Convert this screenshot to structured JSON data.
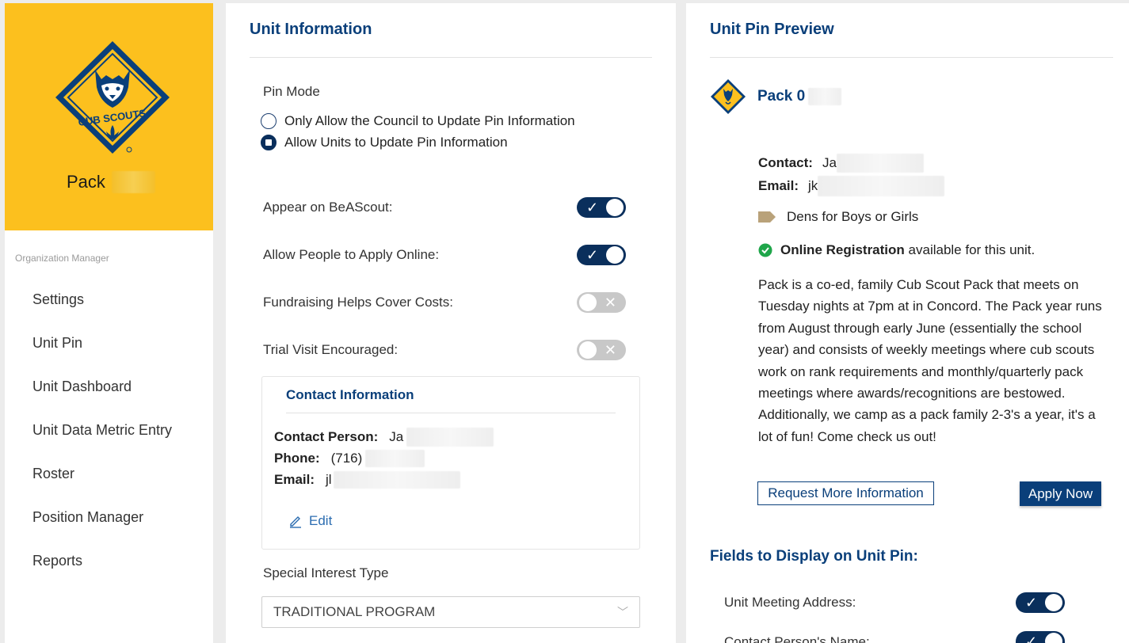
{
  "sidebar": {
    "logo_text": "CUB SCOUTS",
    "pack_name": "Pack",
    "org_label": "Organization Manager",
    "nav": [
      {
        "label": "Settings"
      },
      {
        "label": "Unit Pin"
      },
      {
        "label": "Unit Dashboard"
      },
      {
        "label": "Unit Data Metric Entry"
      },
      {
        "label": "Roster"
      },
      {
        "label": "Position Manager"
      },
      {
        "label": "Reports"
      }
    ]
  },
  "unit_info": {
    "title": "Unit Information",
    "pin_mode_label": "Pin Mode",
    "pin_mode_options": [
      {
        "label": "Only Allow the Council to Update Pin Information",
        "selected": false
      },
      {
        "label": "Allow Units to Update Pin Information",
        "selected": true
      }
    ],
    "toggles": [
      {
        "label": "Appear on BeAScout:",
        "on": true
      },
      {
        "label": "Allow People to Apply Online:",
        "on": true
      },
      {
        "label": "Fundraising Helps Cover Costs:",
        "on": false
      },
      {
        "label": "Trial Visit Encouraged:",
        "on": false
      }
    ],
    "contact": {
      "title": "Contact Information",
      "person_label": "Contact Person:",
      "person_value": "Ja",
      "phone_label": "Phone:",
      "phone_value": "(716)",
      "email_label": "Email:",
      "email_value": "jl",
      "edit_label": "Edit"
    },
    "special_interest_label": "Special Interest Type",
    "special_interest_value": "TRADITIONAL PROGRAM"
  },
  "pin_preview": {
    "title": "Unit Pin Preview",
    "pack_title": "Pack 0",
    "contact_label": "Contact:",
    "contact_value": "Ja",
    "email_label": "Email:",
    "email_value": "jk",
    "dens_text": "Dens for Boys or Girls",
    "online_reg_bold": "Online Registration",
    "online_reg_rest": "available for this unit.",
    "description": "Pack      is a co-ed, family Cub Scout Pack that meets on Tuesday nights at 7pm at                       in Concord. The Pack year runs from August through early June (essentially the school year) and consists of weekly meetings where cub scouts work on rank requirements and monthly/quarterly pack meetings where awards/recognitions are bestowed. Additionally, we camp as a pack family 2-3's a year, it's a lot of fun! Come check us out!",
    "request_btn": "Request More Information",
    "apply_btn": "Apply Now",
    "fields_title": "Fields to Display on Unit Pin:",
    "fields": [
      {
        "label": "Unit Meeting Address:",
        "on": true
      },
      {
        "label": "Contact Person's Name:",
        "on": true
      }
    ]
  },
  "colors": {
    "brand_yellow": "#fcc01e",
    "brand_navy": "#0a3f7a",
    "toggle_on": "#0a2f5c",
    "toggle_off": "#c8c8c8",
    "success_green": "#1fa64a",
    "tag_tan": "#b9a27a"
  }
}
